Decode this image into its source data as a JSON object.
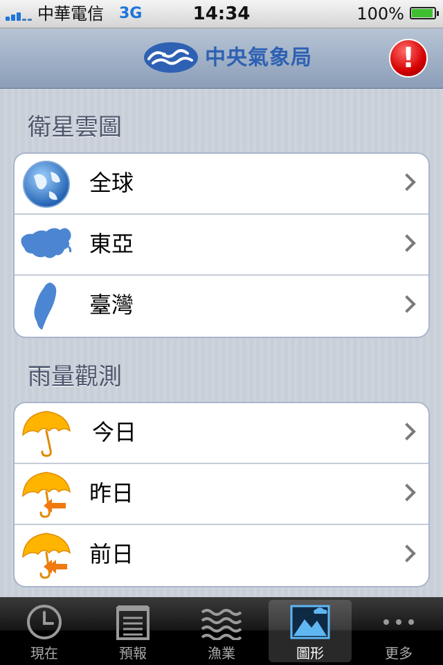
{
  "status_bar": {
    "carrier": "中華電信",
    "network": "3G",
    "time": "14:34",
    "battery_percent": "100%"
  },
  "nav_bar": {
    "title": "中央氣象局",
    "alert_glyph": "!"
  },
  "sections": [
    {
      "title": "衛星雲圖",
      "rows": [
        {
          "label": "全球",
          "icon": "globe-icon"
        },
        {
          "label": "東亞",
          "icon": "east-asia-map-icon"
        },
        {
          "label": "臺灣",
          "icon": "taiwan-map-icon"
        }
      ]
    },
    {
      "title": "雨量觀測",
      "rows": [
        {
          "label": "今日",
          "icon": "umbrella-icon"
        },
        {
          "label": "昨日",
          "icon": "umbrella-back-arrow-icon"
        },
        {
          "label": "前日",
          "icon": "umbrella-double-back-arrow-icon"
        }
      ]
    }
  ],
  "tab_bar": {
    "tabs": [
      {
        "label": "現在",
        "icon": "clock-icon"
      },
      {
        "label": "預報",
        "icon": "calendar-icon"
      },
      {
        "label": "漁業",
        "icon": "waves-icon"
      },
      {
        "label": "圖形",
        "icon": "image-icon",
        "selected": true
      },
      {
        "label": "更多",
        "icon": "more-icon"
      }
    ]
  },
  "colors": {
    "accent_blue": "#2e61b3",
    "alert_red": "#d50000",
    "umbrella_yellow": "#ffb400",
    "arrow_orange": "#f07a10"
  }
}
